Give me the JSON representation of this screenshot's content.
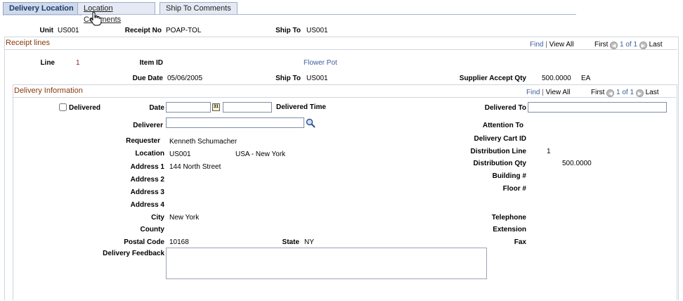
{
  "tabs": [
    {
      "label": "Delivery Location",
      "active": true
    },
    {
      "label": "Location Comments",
      "active": false
    },
    {
      "label": "Ship To Comments",
      "active": false
    }
  ],
  "header": {
    "unit_label": "Unit",
    "unit_value": "US001",
    "receipt_label": "Receipt No",
    "receipt_value": "POAP-TOL",
    "shipto_label": "Ship To",
    "shipto_value": "US001"
  },
  "receipt_lines": {
    "title": "Receipt lines",
    "nav": {
      "find": "Find",
      "view_all": "View All",
      "first": "First",
      "count": "1 of 1",
      "last": "Last"
    },
    "line_label": "Line",
    "line_value": "1",
    "item_label": "Item ID",
    "item_value": "Flower Pot",
    "due_label": "Due Date",
    "due_value": "05/06/2005",
    "shipto_label": "Ship To",
    "shipto_value": "US001",
    "supplier_qty_label": "Supplier Accept Qty",
    "supplier_qty_value": "500.0000",
    "supplier_qty_uom": "EA"
  },
  "delivery_info": {
    "title": "Delivery Information",
    "nav": {
      "find": "Find",
      "view_all": "View All",
      "first": "First",
      "count": "1 of 1",
      "last": "Last"
    },
    "delivered_label": "Delivered",
    "date_label": "Date",
    "delivered_time_label": "Delivered Time",
    "delivered_to_label": "Delivered To",
    "deliverer_label": "Deliverer",
    "attention_label": "Attention To",
    "requester_label": "Requester",
    "requester_value": "Kenneth Schumacher",
    "cart_label": "Delivery Cart ID",
    "location_label": "Location",
    "location_value": "US001",
    "location_desc": "USA - New York",
    "dist_line_label": "Distribution Line",
    "dist_line_value": "1",
    "address1_label": "Address 1",
    "address1_value": "144 North Street",
    "dist_qty_label": "Distribution Qty",
    "dist_qty_value": "500.0000",
    "address2_label": "Address 2",
    "building_label": "Building #",
    "address3_label": "Address 3",
    "floor_label": "Floor #",
    "address4_label": "Address 4",
    "city_label": "City",
    "city_value": "New York",
    "telephone_label": "Telephone",
    "county_label": "County",
    "extension_label": "Extension",
    "postal_label": "Postal Code",
    "postal_value": "10168",
    "state_label": "State",
    "state_value": "NY",
    "fax_label": "Fax",
    "feedback_label": "Delivery Feedback"
  }
}
